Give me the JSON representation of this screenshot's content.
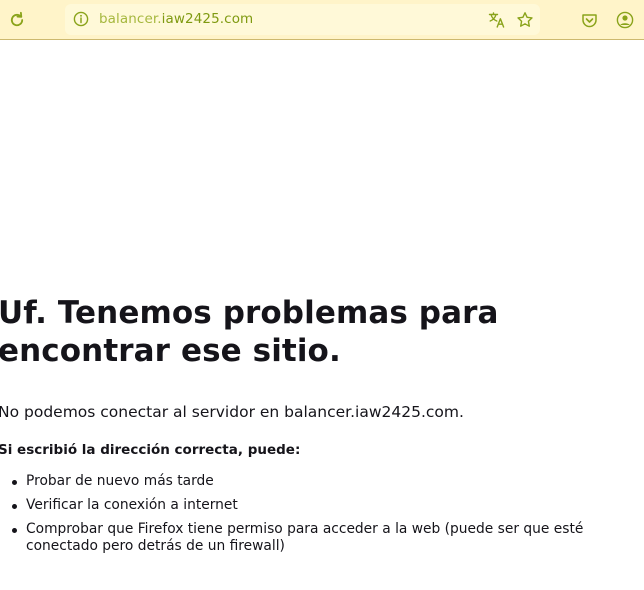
{
  "toolbar": {
    "url_prefix": "balancer.",
    "url_host": "iaw2425.com",
    "icons": {
      "reload": "reload-icon",
      "info": "info-icon",
      "translate": "translate-icon",
      "bookmark": "star-icon",
      "pocket": "pocket-icon",
      "account": "account-icon"
    }
  },
  "error": {
    "title": "Uf. Tenemos problemas para encontrar ese sitio.",
    "description": "No podemos conectar al servidor en balancer.iaw2425.com.",
    "subheading": "Si escribió la dirección correcta, puede:",
    "suggestions": [
      "Probar de nuevo más tarde",
      "Verificar la conexión a internet",
      "Comprobar que Firefox tiene permiso para acceder a la web (puede ser que esté conectado pero detrás de un firewall)"
    ]
  },
  "colors": {
    "toolbar_bg": "#fff4c9",
    "accent": "#8aa31a",
    "text": "#15141a"
  }
}
